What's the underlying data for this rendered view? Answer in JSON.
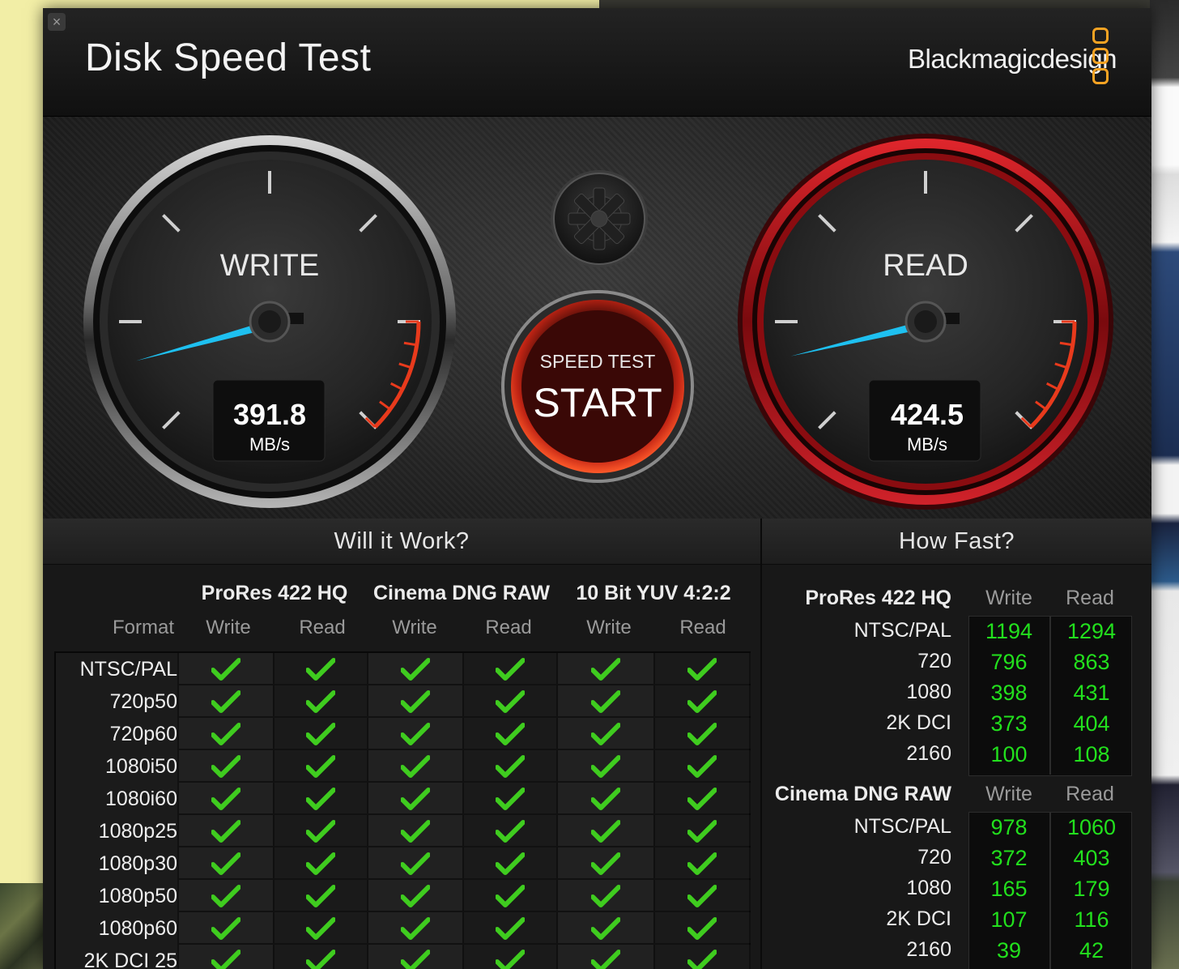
{
  "window": {
    "close_label": "×",
    "title": "Disk Speed Test",
    "brand": "Blackmagicdesign"
  },
  "gauges": {
    "write": {
      "label": "WRITE",
      "value": "391.8",
      "unit": "MB/s",
      "needle_angle_deg": 100
    },
    "read": {
      "label": "READ",
      "value": "424.5",
      "unit": "MB/s",
      "needle_angle_deg": 98
    }
  },
  "start_button": {
    "top": "SPEED TEST",
    "main": "START"
  },
  "settings_button": {
    "icon": "gear-icon"
  },
  "will_it_work": {
    "title": "Will it Work?",
    "format_header": "Format",
    "codecs": [
      "ProRes 422 HQ",
      "Cinema DNG RAW",
      "10 Bit YUV 4:2:2"
    ],
    "columns": [
      "Write",
      "Read",
      "Write",
      "Read",
      "Write",
      "Read"
    ],
    "rows": [
      {
        "format": "NTSC/PAL"
      },
      {
        "format": "720p50"
      },
      {
        "format": "720p60"
      },
      {
        "format": "1080i50"
      },
      {
        "format": "1080i60"
      },
      {
        "format": "1080p25"
      },
      {
        "format": "1080p30"
      },
      {
        "format": "1080p50"
      },
      {
        "format": "1080p60"
      },
      {
        "format": "2K DCI 25"
      }
    ],
    "check_color": "#3fcc1f"
  },
  "how_fast": {
    "title": "How Fast?",
    "write_label": "Write",
    "read_label": "Read",
    "groups": [
      {
        "codec": "ProRes 422 HQ",
        "rows": [
          {
            "format": "NTSC/PAL",
            "write": "1194",
            "read": "1294"
          },
          {
            "format": "720",
            "write": "796",
            "read": "863"
          },
          {
            "format": "1080",
            "write": "398",
            "read": "431"
          },
          {
            "format": "2K DCI",
            "write": "373",
            "read": "404"
          },
          {
            "format": "2160",
            "write": "100",
            "read": "108"
          }
        ]
      },
      {
        "codec": "Cinema DNG RAW",
        "rows": [
          {
            "format": "NTSC/PAL",
            "write": "978",
            "read": "1060"
          },
          {
            "format": "720",
            "write": "372",
            "read": "403"
          },
          {
            "format": "1080",
            "write": "165",
            "read": "179"
          },
          {
            "format": "2K DCI",
            "write": "107",
            "read": "116"
          },
          {
            "format": "2160",
            "write": "39",
            "read": "42"
          }
        ]
      }
    ],
    "value_color": "#22e01d"
  },
  "colors": {
    "accent": "#f5a323",
    "needle": "#1ec0f0",
    "read_ring": "#b0141a",
    "redline": "#e83a1c"
  }
}
